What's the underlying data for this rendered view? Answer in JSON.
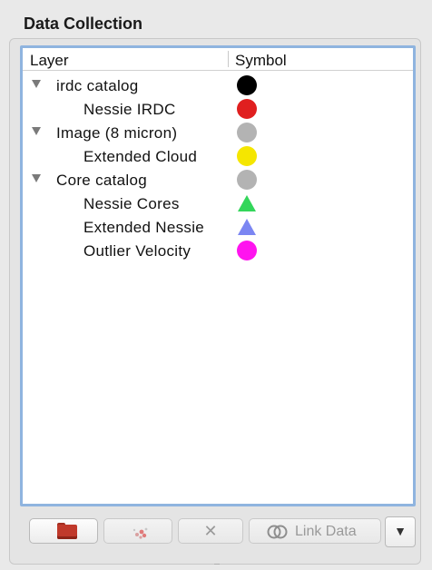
{
  "panel": {
    "title": "Data Collection"
  },
  "tree": {
    "columns": {
      "layer": "Layer",
      "symbol": "Symbol"
    },
    "rows": [
      {
        "label": "irdc catalog",
        "level": 0,
        "expanded": true,
        "symbol": "circle",
        "color": "#000000"
      },
      {
        "label": "Nessie IRDC",
        "level": 1,
        "symbol": "circle",
        "color": "#e01f1f"
      },
      {
        "label": "Image (8 micron)",
        "level": 0,
        "expanded": true,
        "symbol": "circle",
        "color": "#b3b3b3"
      },
      {
        "label": "Extended Cloud",
        "level": 1,
        "symbol": "circle",
        "color": "#f5e600"
      },
      {
        "label": "Core catalog",
        "level": 0,
        "expanded": true,
        "symbol": "circle",
        "color": "#b3b3b3"
      },
      {
        "label": "Nessie Cores",
        "level": 1,
        "symbol": "triangle",
        "color": "#33d65a"
      },
      {
        "label": "Extended Nessie",
        "level": 1,
        "symbol": "triangle",
        "color": "#7b86f2"
      },
      {
        "label": "Outlier Velocity",
        "level": 1,
        "symbol": "circle",
        "color": "#ff14ef"
      }
    ]
  },
  "toolbar": {
    "link_label": "Link Data",
    "remove_glyph": "✕",
    "menu_glyph": "▼",
    "icons": {
      "load": "folder-icon",
      "new_subset": "scatter-subset-icon",
      "remove": "close-icon",
      "link": "link-rings-icon",
      "menu": "dropdown-arrow-icon"
    }
  }
}
